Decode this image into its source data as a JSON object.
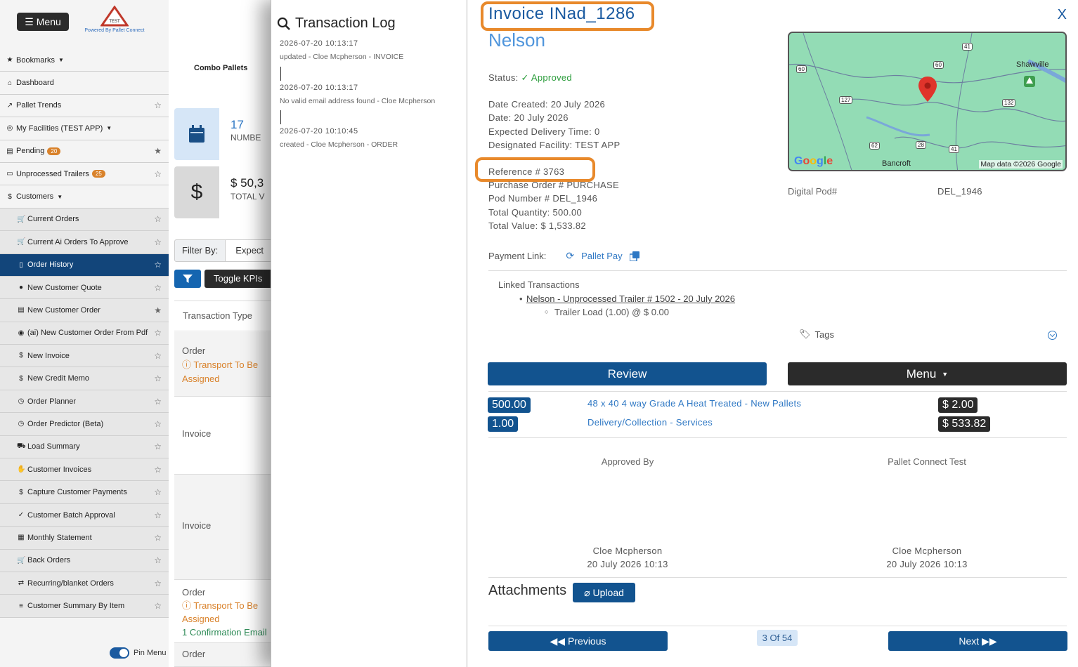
{
  "sidebar": {
    "menu_label": "Menu",
    "logo_text": "PALLET CONNECT TEST",
    "powered_by": "Powered By Pallet Connect",
    "pin_label": "Pin Menu",
    "items": [
      {
        "label": "Bookmarks",
        "icon": "star-icon"
      },
      {
        "label": "Dashboard",
        "icon": "home-icon"
      },
      {
        "label": "Pallet Trends",
        "icon": "chart-icon"
      },
      {
        "label": "My Facilities (TEST APP)",
        "icon": "globe-icon"
      },
      {
        "label": "Pending",
        "icon": "document-icon",
        "badge": "20"
      },
      {
        "label": "Unprocessed Trailers",
        "icon": "trailer-icon",
        "badge": "25"
      },
      {
        "label": "Customers",
        "icon": "dollar-icon"
      },
      {
        "label": "Current Orders",
        "icon": "cart-icon"
      },
      {
        "label": "Current Ai Orders To Approve",
        "icon": "cart-icon"
      },
      {
        "label": "Order History",
        "icon": "file-icon"
      },
      {
        "label": "New Customer Quote",
        "icon": "comment-icon"
      },
      {
        "label": "New Customer Order",
        "icon": "list-icon"
      },
      {
        "label": "(ai) New Customer Order From Pdf",
        "icon": "robot-icon"
      },
      {
        "label": "New Invoice",
        "icon": "dollar-icon"
      },
      {
        "label": "New Credit Memo",
        "icon": "dollar-icon"
      },
      {
        "label": "Order Planner",
        "icon": "clock-icon"
      },
      {
        "label": "Order Predictor (Beta)",
        "icon": "clock-icon"
      },
      {
        "label": "Load Summary",
        "icon": "truck-icon"
      },
      {
        "label": "Customer Invoices",
        "icon": "hand-icon"
      },
      {
        "label": "Capture Customer Payments",
        "icon": "dollar-icon"
      },
      {
        "label": "Customer Batch Approval",
        "icon": "check-icon"
      },
      {
        "label": "Monthly Statement",
        "icon": "table-icon"
      },
      {
        "label": "Back Orders",
        "icon": "cart-icon"
      },
      {
        "label": "Recurring/blanket Orders",
        "icon": "repeat-icon"
      },
      {
        "label": "Customer Summary By Item",
        "icon": "bars-icon"
      }
    ]
  },
  "main": {
    "tab_title": "Combo Pallets",
    "kpi1_value": "17",
    "kpi1_label": "NUMBE",
    "kpi2_value": "$ 50,3",
    "kpi2_label": "TOTAL V",
    "kpi2_icon": "$",
    "filter_label": "Filter By:",
    "filter_value": "Expect",
    "toggle_kpis": "Toggle KPIs",
    "col_header": "Transaction Type",
    "rows": [
      {
        "type": "Order",
        "status": "Transport To Be Assigned"
      },
      {
        "type": "Invoice"
      },
      {
        "type": "Invoice"
      },
      {
        "type": "Order",
        "status": "Transport To Be Assigned",
        "extra": "1 Confirmation Email"
      },
      {
        "type": "Order"
      }
    ]
  },
  "txlog": {
    "title": "Transaction Log",
    "entries": [
      {
        "date": "2026-07-20 10:13:17",
        "msg": "updated - Cloe Mcpherson - INVOICE"
      },
      {
        "date": "2026-07-20 10:13:17",
        "msg": "No valid email address found - Cloe Mcpherson"
      },
      {
        "date": "2026-07-20 10:10:45",
        "msg": "created - Cloe Mcpherson - ORDER"
      }
    ]
  },
  "invoice": {
    "title": "Invoice INad_1286",
    "customer": "Nelson",
    "close": "X",
    "status_label": "Status:",
    "status_value": "Approved",
    "date_created": "Date Created: 20 July 2026",
    "date": "Date: 20 July 2026",
    "expected_delivery": "Expected Delivery Time: 0",
    "facility": "Designated Facility: TEST APP",
    "reference": "Reference # 3763",
    "purchase_order": "Purchase Order # PURCHASE",
    "pod_number": "Pod Number # DEL_1946",
    "total_quantity": "Total Quantity: 500.00",
    "total_value": "Total Value: $ 1,533.82",
    "digital_pod_label": "Digital Pod#",
    "digital_pod_value": "DEL_1946",
    "payment_label": "Payment Link:",
    "payment_link": "Pallet Pay",
    "linked_title": "Linked Transactions",
    "linked_item": "Nelson - Unprocessed Trailer # 1502 - 20 July 2026",
    "linked_sub": "Trailer Load (1.00) @ $ 0.00",
    "tags_label": "Tags",
    "review_label": "Review",
    "menu_label": "Menu",
    "lines": [
      {
        "qty": "500.00",
        "product": "48 x 40 4 way Grade A Heat Treated - New Pallets",
        "price": "$ 2.00"
      },
      {
        "qty": "1.00",
        "product": "Delivery/Collection - Services",
        "price": "$ 533.82"
      }
    ],
    "approved_by_label": "Approved By",
    "company_label": "Pallet Connect Test",
    "sig1_name": "Cloe Mcpherson",
    "sig1_date": "20 July 2026 10:13",
    "sig2_name": "Cloe Mcpherson",
    "sig2_date": "20 July 2026 10:13",
    "attachments_label": "Attachments",
    "upload_label": "Upload",
    "previous_label": "Previous",
    "next_label": "Next",
    "pager": "3 Of 54",
    "map": {
      "town1": "Shawville",
      "town2": "Bancroft",
      "attribution": "Map data ©2026 Google",
      "hwy": [
        "41",
        "60",
        "60",
        "127",
        "132",
        "62",
        "28",
        "41"
      ]
    }
  }
}
